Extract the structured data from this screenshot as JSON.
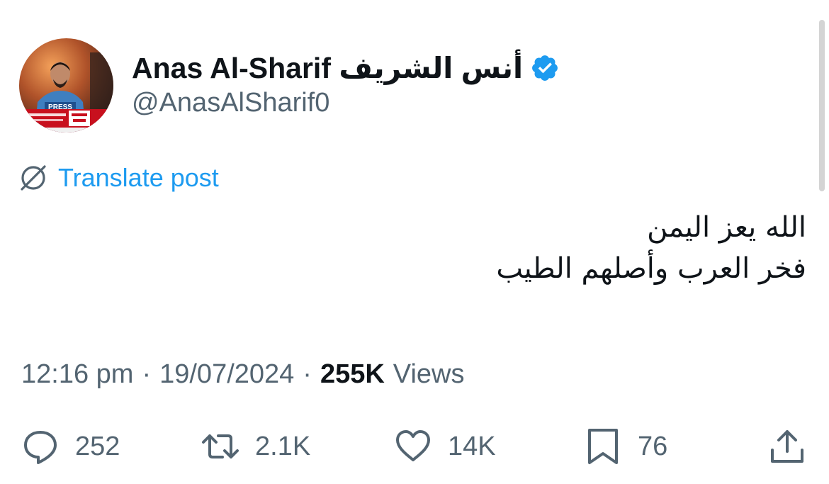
{
  "author": {
    "display_name": "Anas Al-Sharif أنس الشريف",
    "handle": "@AnasAlSharif0",
    "verified": true,
    "avatar_badge_text": "PRESS"
  },
  "translate": {
    "label": "Translate post",
    "icon": "globe-slash-icon"
  },
  "post": {
    "lines": [
      "الله يعز اليمن",
      "فخر العرب وأصلهم الطيب"
    ]
  },
  "meta": {
    "time": "12:16 pm",
    "separator": "·",
    "date": "19/07/2024",
    "views_count": "255K",
    "views_label": "Views"
  },
  "actions": {
    "reply": {
      "icon": "reply-icon",
      "count": "252"
    },
    "repost": {
      "icon": "repost-icon",
      "count": "2.1K"
    },
    "like": {
      "icon": "heart-icon",
      "count": "14K"
    },
    "bookmark": {
      "icon": "bookmark-icon",
      "count": "76"
    },
    "share": {
      "icon": "share-icon"
    }
  },
  "colors": {
    "text": "#0f1419",
    "secondary": "#536471",
    "accent": "#1d9bf0"
  }
}
